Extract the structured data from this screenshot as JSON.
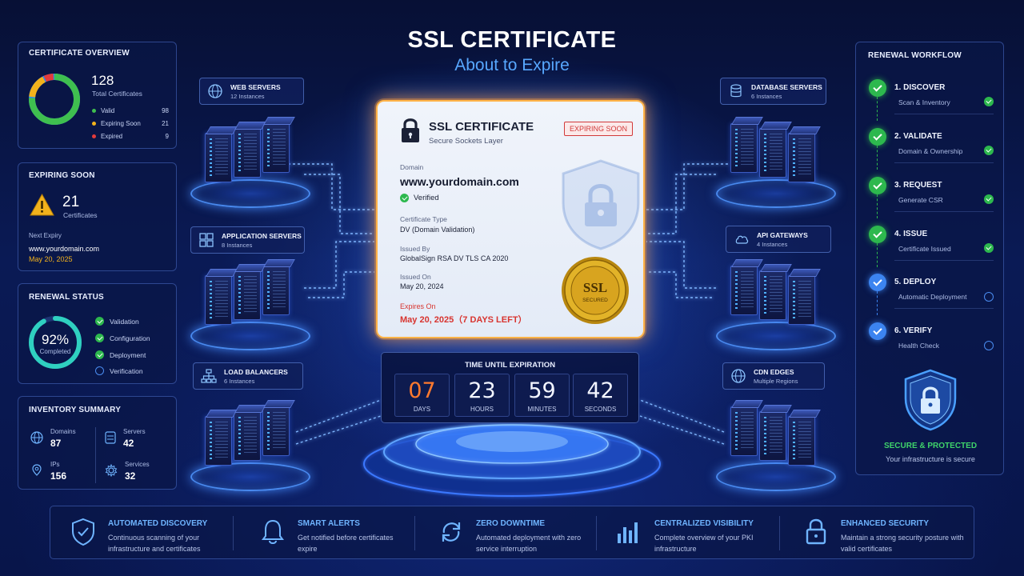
{
  "title": "SSL CERTIFICATE",
  "subtitle": "About to Expire",
  "overview": {
    "title": "CERTIFICATE OVERVIEW",
    "total": "128",
    "total_label": "Total Certificates",
    "legend": [
      {
        "label": "Valid",
        "value": "98",
        "color": "#3fbf4f"
      },
      {
        "label": "Expiring Soon",
        "value": "21",
        "color": "#f2b21c"
      },
      {
        "label": "Expired",
        "value": "9",
        "color": "#e23b3b"
      }
    ],
    "ring_colors": {
      "valid": "#3fbf4f",
      "soon": "#f2b21c",
      "expired": "#e23b3b",
      "base": "#2d8cf0"
    }
  },
  "expiring": {
    "title": "EXPIRING SOON",
    "count": "21",
    "count_label": "Certificates",
    "next_label": "Next Expiry",
    "next_domain": "www.yourdomain.com",
    "next_date": "May 20, 2025"
  },
  "renewal": {
    "title": "RENEWAL STATUS",
    "percent": "92%",
    "percent_value": 0.92,
    "percent_label": "Completed",
    "items": [
      {
        "label": "Validation",
        "done": true
      },
      {
        "label": "Configuration",
        "done": true
      },
      {
        "label": "Deployment",
        "done": true
      },
      {
        "label": "Verification",
        "done": false
      }
    ]
  },
  "inventory": {
    "title": "INVENTORY SUMMARY",
    "items": [
      {
        "label": "Domains",
        "value": "87",
        "icon": "globe-icon"
      },
      {
        "label": "Servers",
        "value": "42",
        "icon": "server-icon"
      },
      {
        "label": "IPs",
        "value": "156",
        "icon": "location-icon"
      },
      {
        "label": "Services",
        "value": "32",
        "icon": "gear-icon"
      }
    ]
  },
  "servers": {
    "web": {
      "name": "WEB SERVERS",
      "sub": "12 Instances"
    },
    "app": {
      "name": "APPLICATION SERVERS",
      "sub": "8 Instances"
    },
    "lb": {
      "name": "LOAD BALANCERS",
      "sub": "6 Instances"
    },
    "db": {
      "name": "DATABASE SERVERS",
      "sub": "6 Instances"
    },
    "api": {
      "name": "API GATEWAYS",
      "sub": "4 Instances"
    },
    "cdn": {
      "name": "CDN EDGES",
      "sub": "Multiple Regions"
    }
  },
  "certificate": {
    "title": "SSL CERTIFICATE",
    "sub": "Secure Sockets Layer",
    "badge": "EXPIRING SOON",
    "domain_label": "Domain",
    "domain": "www.yourdomain.com",
    "verified": "Verified",
    "type_label": "Certificate Type",
    "type": "DV (Domain Validation)",
    "issuer_label": "Issued By",
    "issuer": "GlobalSign RSA DV TLS CA 2020",
    "issued_label": "Issued On",
    "issued": "May 20, 2024",
    "expires_label": "Expires On",
    "expires": "May 20, 2025（7 DAYS LEFT）",
    "seal_text": "SSL",
    "seal_sub": "SECURED"
  },
  "countdown": {
    "title": "TIME UNTIL EXPIRATION",
    "units": [
      {
        "value": "07",
        "label": "DAYS"
      },
      {
        "value": "23",
        "label": "HOURS"
      },
      {
        "value": "59",
        "label": "MINUTES"
      },
      {
        "value": "42",
        "label": "SECONDS"
      }
    ]
  },
  "workflow": {
    "title": "RENEWAL WORKFLOW",
    "steps": [
      {
        "name": "1.  DISCOVER",
        "desc": "Scan & Inventory",
        "done": true
      },
      {
        "name": "2.  VALIDATE",
        "desc": "Domain & Ownership",
        "done": true
      },
      {
        "name": "3.  REQUEST",
        "desc": "Generate CSR",
        "done": true
      },
      {
        "name": "4.  ISSUE",
        "desc": "Certificate Issued",
        "done": true
      },
      {
        "name": "5.  DEPLOY",
        "desc": "Automatic Deployment",
        "done": false
      },
      {
        "name": "6.  VERIFY",
        "desc": "Health Check",
        "done": false
      }
    ],
    "secure_title": "SECURE & PROTECTED",
    "secure_sub": "Your infrastructure is secure"
  },
  "features": [
    {
      "title": "AUTOMATED DISCOVERY",
      "desc": "Continuous scanning of your infrastructure and certificates",
      "icon": "shield-icon"
    },
    {
      "title": "SMART ALERTS",
      "desc": "Get notified before certificates expire",
      "icon": "bell-icon"
    },
    {
      "title": "ZERO DOWNTIME",
      "desc": "Automated deployment with zero service interruption",
      "icon": "refresh-icon"
    },
    {
      "title": "CENTRALIZED VISIBILITY",
      "desc": "Complete overview of your PKI infrastructure",
      "icon": "bar-chart-icon"
    },
    {
      "title": "ENHANCED SECURITY",
      "desc": "Maintain a strong security posture with valid certificates",
      "icon": "lock-icon"
    }
  ]
}
